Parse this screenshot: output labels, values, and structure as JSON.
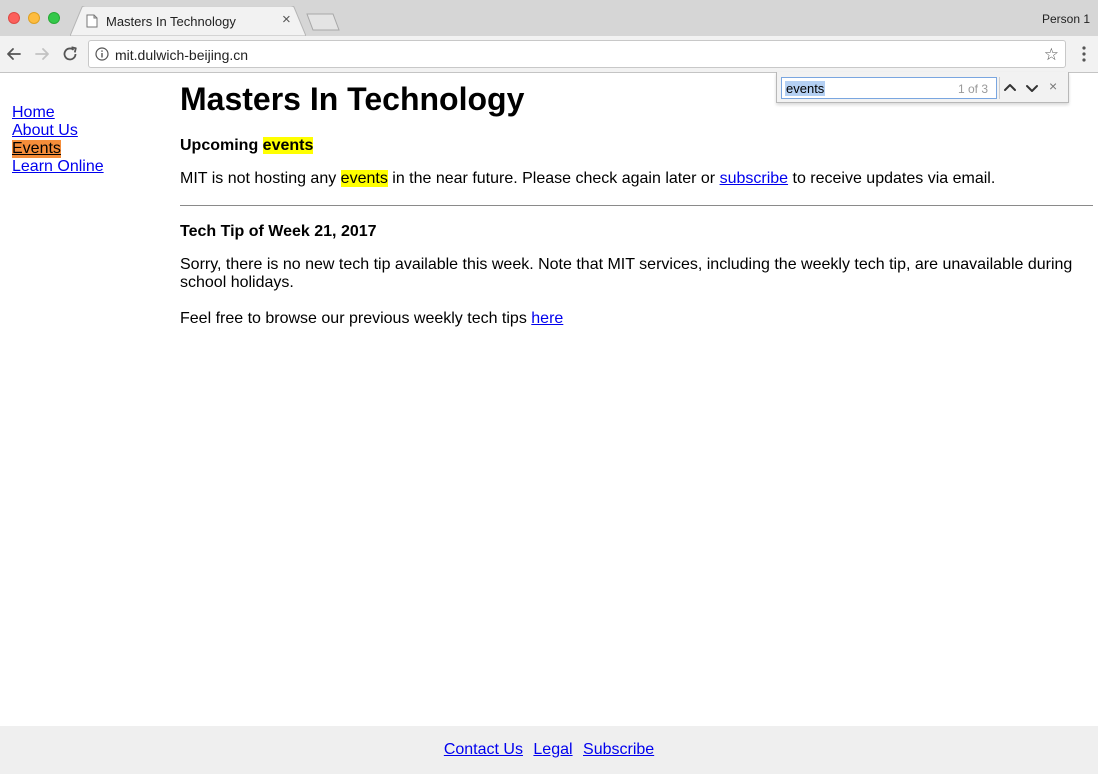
{
  "browser": {
    "tab_title": "Masters In Technology",
    "tab_close": "×",
    "profile_name": "Person 1",
    "url": "mit.dulwich-beijing.cn",
    "bookmark_icon": "star-icon"
  },
  "find_bar": {
    "query": "events",
    "match_count": "1 of 3",
    "close_label": "×"
  },
  "sidebar": {
    "items": [
      {
        "label": "Home"
      },
      {
        "label": "About Us"
      },
      {
        "label": "Events"
      },
      {
        "label": "Learn Online"
      }
    ]
  },
  "main": {
    "title": "Masters In Technology",
    "upcoming": {
      "heading_prefix": "Upcoming ",
      "heading_highlight": "events",
      "text_before": "MIT is not hosting any ",
      "text_highlight": "events",
      "text_middle": " in the near future. Please check again later or ",
      "link": "subscribe",
      "text_after": " to receive updates via email."
    },
    "tech_tip": {
      "heading": "Tech Tip of Week 21, 2017",
      "body": "Sorry, there is no new tech tip available this week. Note that MIT services, including the weekly tech tip, are unavailable during school holidays.",
      "browse_text": "Feel free to browse our previous weekly tech tips ",
      "browse_link": "here"
    }
  },
  "footer": {
    "links": [
      "Contact Us",
      "Legal",
      "Subscribe"
    ]
  },
  "colors": {
    "highlight": "#ffff00",
    "current_match": "#f58d3a",
    "link": "#0000ee"
  }
}
